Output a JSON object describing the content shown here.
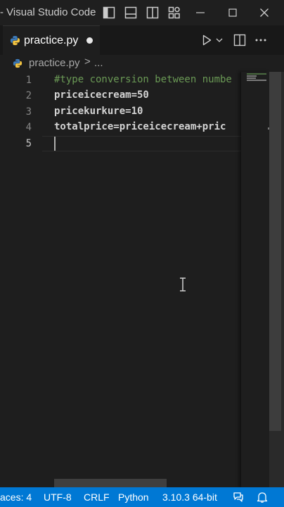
{
  "window": {
    "title": "- Visual Studio Code"
  },
  "tab": {
    "filename": "practice.py",
    "dirty": true
  },
  "breadcrumb": {
    "file": "practice.py",
    "separator": ">",
    "symbol": "..."
  },
  "editor": {
    "lines": [
      {
        "number": "1",
        "text": "#type conversion between numbe"
      },
      {
        "number": "2",
        "text": "priceicecream=50"
      },
      {
        "number": "3",
        "text": "pricekurkure=10"
      },
      {
        "number": "4",
        "text": "totalprice=priceicecream+pric"
      },
      {
        "number": "5",
        "text": ""
      }
    ],
    "current_line": 5
  },
  "statusbar": {
    "spaces": "aces: 4",
    "encoding": "UTF-8",
    "eol": "CRLF",
    "language": "Python",
    "interpreter": "3.10.3 64-bit"
  },
  "colors": {
    "accent": "#0078d4",
    "comment": "#6a9955",
    "editor_bg": "#1e1e1e",
    "python_blue": "#3d7ab8",
    "python_yellow": "#f4c542"
  },
  "icons": {
    "titlebar": [
      "toggle-primary-sidebar-icon",
      "toggle-panel-icon",
      "toggle-secondary-sidebar-icon",
      "customize-layout-icon",
      "minimize-icon",
      "maximize-icon",
      "close-icon"
    ],
    "editor_actions": [
      "run-python-file-icon",
      "chevron-down-icon",
      "split-editor-icon",
      "more-actions-icon"
    ],
    "statusbar": [
      "feedback-icon",
      "notifications-bell-icon"
    ]
  }
}
